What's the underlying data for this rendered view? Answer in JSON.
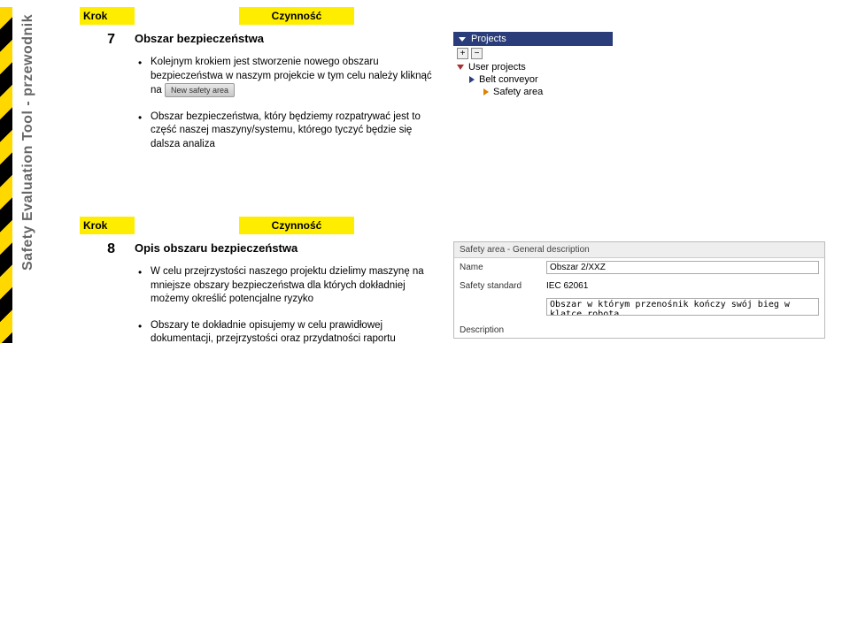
{
  "sidebar": {
    "vertical_label": "Safety Evaluation Tool - przewodnik"
  },
  "steps": [
    {
      "krok_label": "Krok",
      "czyn_label": "Czynność",
      "number": "7",
      "title": "Obszar bezpieczeństwa",
      "bullets": [
        "Kolejnym krokiem jest stworzenie nowego obszaru bezpieczeństwa w naszym projekcie w tym celu należy kliknąć na",
        "Obszar bezpieczeństwa, który będziemy rozpatrywać jest to część naszej maszyny/systemu, którego tyczyć będzie się dalsza analiza"
      ],
      "button_label": "New safety area"
    },
    {
      "krok_label": "Krok",
      "czyn_label": "Czynność",
      "number": "8",
      "title": "Opis obszaru bezpieczeństwa",
      "bullets": [
        "W celu przejrzystości naszego projektu dzielimy maszynę na mniejsze obszary bezpieczeństwa dla których dokładniej możemy określić potencjalne ryzyko",
        "Obszary te dokładnie opisujemy w celu prawidłowej dokumentacji, przejrzystości oraz przydatności raportu"
      ]
    }
  ],
  "projects_panel": {
    "header": "Projects",
    "items": [
      {
        "label": "User projects"
      },
      {
        "label": "Belt conveyor"
      },
      {
        "label": "Safety area"
      }
    ]
  },
  "form": {
    "title": "Safety area - General description",
    "name_label": "Name",
    "name_value": "Obszar 2/XXZ",
    "std_label": "Safety standard",
    "std_value": "IEC 62061",
    "desc_label": "Description",
    "desc_value": "Obszar w którym przenośnik kończy swój bieg w klatce robota"
  }
}
